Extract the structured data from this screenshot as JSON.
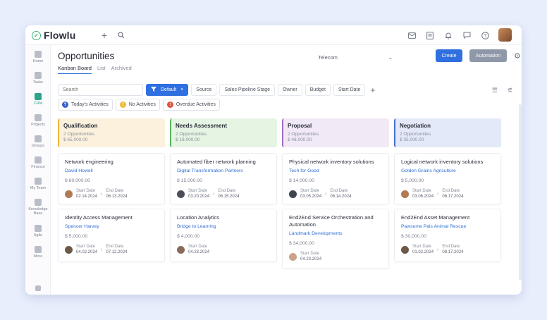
{
  "app": {
    "name": "Flowlu"
  },
  "sidebar": {
    "items": [
      {
        "label": "Home",
        "icon": "home-icon"
      },
      {
        "label": "Tasks",
        "icon": "tasks-icon"
      },
      {
        "label": "CRM",
        "icon": "crm-icon",
        "active": true
      },
      {
        "label": "Projects",
        "icon": "projects-icon"
      },
      {
        "label": "Groups",
        "icon": "groups-icon"
      },
      {
        "label": "Finance",
        "icon": "finance-icon"
      },
      {
        "label": "My Team",
        "icon": "team-icon"
      },
      {
        "label": "Knowledge",
        "label2": "Base",
        "icon": "knowledge-base-icon"
      },
      {
        "label": "Agile",
        "icon": "agile-icon"
      },
      {
        "label": "More",
        "icon": "more-icon"
      }
    ]
  },
  "header": {
    "title": "Opportunities",
    "tabs": [
      {
        "label": "Kanban Board",
        "active": true
      },
      {
        "label": "List"
      },
      {
        "label": "Archived"
      }
    ],
    "pipeline": "Telecom",
    "create_label": "Create",
    "automation_label": "Automation"
  },
  "filters": {
    "search_placeholder": "Search",
    "default_label": "Default",
    "chips": [
      "Source",
      "Sales Pipeline Stage",
      "Owner",
      "Budget",
      "Start Date"
    ],
    "activities": [
      {
        "label": "Today's Activities",
        "color": "#3a5fc8",
        "glyph": "?"
      },
      {
        "label": "No Activities",
        "color": "#f2b93b",
        "glyph": "!"
      },
      {
        "label": "Overdue Activities",
        "color": "#e0533f",
        "glyph": "!"
      }
    ]
  },
  "columns": [
    {
      "name": "Qualification",
      "count": "2 Opportunities",
      "total": "$ 65,000.00",
      "bg": "#fbf1dd",
      "accent": "#f0b440"
    },
    {
      "name": "Needs Assessment",
      "count": "2 Opportunities",
      "total": "$ 19,000.00",
      "bg": "#e6f4e4",
      "accent": "#59b55a"
    },
    {
      "name": "Proposal",
      "count": "2 Opportunities",
      "total": "$ 48,000.00",
      "bg": "#f1e9f6",
      "accent": "#a06cc2"
    },
    {
      "name": "Negotiation",
      "count": "2 Opportunities",
      "total": "$ 35,000.00",
      "bg": "#e4e9f9",
      "accent": "#4a6ed0"
    }
  ],
  "cards": [
    [
      {
        "title": "Network engineering",
        "contact": "David Howell",
        "amount": "$ 60,000.00",
        "start_label": "Start Date",
        "start": "02.14.2024",
        "end_label": "End Date",
        "end": "06.13.2024"
      },
      {
        "title": "Identity Access Management",
        "contact": "Spencer Harvey",
        "amount": "$ 5,000.00",
        "start_label": "Start Date",
        "start": "04.02.2024",
        "end_label": "End Date",
        "end": "07.12.2024"
      }
    ],
    [
      {
        "title": "Automated fiber network planning",
        "contact": "Digital Transformation Partners",
        "amount": "$ 15,000.00",
        "start_label": "Start Date",
        "start": "03.20.2024",
        "end_label": "End Date",
        "end": "06.15.2024"
      },
      {
        "title": "Location Analytics",
        "contact": "Bridge to Learning",
        "amount": "$ 4,000.00",
        "start_label": "Start Date",
        "start": "04.23.2024"
      }
    ],
    [
      {
        "title": "Physical network inventory solutions",
        "contact": "Tech for Good",
        "amount": "$ 14,000.00",
        "start_label": "Start Date",
        "start": "03.05.2024",
        "end_label": "End Date",
        "end": "06.14.2024"
      },
      {
        "title": "End2End Service Orchestration and Automation",
        "contact": "Landmark Developments",
        "amount": "$ 34,000.00",
        "start_label": "Start Date",
        "start": "04.23.2024"
      }
    ],
    [
      {
        "title": "Logical network inventory solutions",
        "contact": "Golden Grains Agriculture",
        "amount": "$ 5,000.00",
        "start_label": "Start Date",
        "start": "03.06.2024",
        "end_label": "End Date",
        "end": "06.17.2024"
      },
      {
        "title": "End2End Asset Management",
        "contact": "Pawsome Pals Animal Rescue",
        "amount": "$ 30,000.00",
        "start_label": "Start Date",
        "start": "01.02.2024",
        "end_label": "End Date",
        "end": "08.17.2024"
      }
    ]
  ]
}
